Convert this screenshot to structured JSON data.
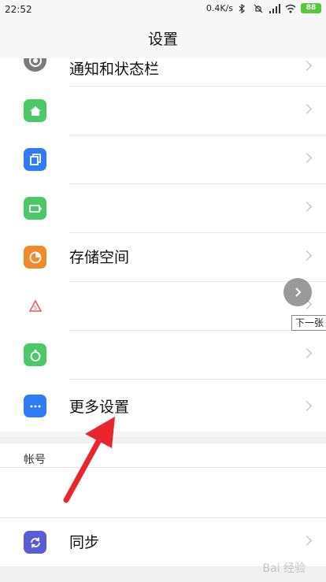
{
  "status_bar": {
    "time": "22:52",
    "speed": "0.4K/s",
    "battery": "88"
  },
  "header": {
    "title": "设置"
  },
  "items": [
    {
      "label": "通知和状态栏",
      "icon": "notification-icon",
      "color": "#7a7a7a"
    },
    {
      "label": "",
      "icon": "home-icon",
      "color": "#4cc868"
    },
    {
      "label": "",
      "icon": "copy-icon",
      "color": "#2f7bf5"
    },
    {
      "label": "",
      "icon": "battery-icon",
      "color": "#4cc868"
    },
    {
      "label": "存储空间",
      "icon": "storage-pie-icon",
      "color": "#f08a2b"
    },
    {
      "label": "",
      "icon": "security-icon",
      "color": "#e35a5a"
    },
    {
      "label": "",
      "icon": "timer-icon",
      "color": "#4cc868"
    },
    {
      "label": "更多设置",
      "icon": "more-icon",
      "color": "#2f7bf5"
    }
  ],
  "section": {
    "title": "帐号"
  },
  "sync": {
    "label": "同步",
    "icon": "sync-icon",
    "color": "#5b5bd6"
  },
  "overlay": {
    "next_tooltip": "下一张"
  },
  "annotation": {
    "arrow_color": "#e8262b"
  },
  "watermark": "Bai 经验"
}
